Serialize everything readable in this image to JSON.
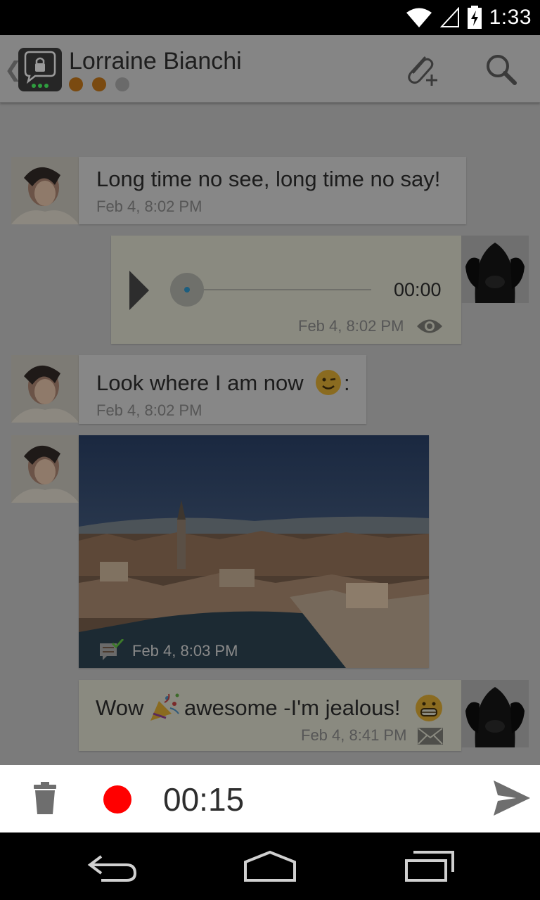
{
  "status_bar": {
    "time": "1:33",
    "icons": [
      "wifi-icon",
      "cell-signal-icon",
      "battery-charging-icon"
    ]
  },
  "header": {
    "back_icon": "chevron-left-icon",
    "app_icon": "locked-chat-icon",
    "contact_name": "Lorraine Bianchi",
    "trust_level_colors": [
      "#b3690d",
      "#b3690d",
      "#9e9e9e"
    ],
    "actions": [
      "attach-add-icon",
      "search-icon"
    ]
  },
  "messages": [
    {
      "direction": "incoming",
      "type": "text",
      "text": "Long time no see, long time no say!",
      "time": "Feb 4, 8:02 PM"
    },
    {
      "direction": "outgoing",
      "type": "audio",
      "duration": "00:00",
      "time": "Feb 4, 8:02 PM",
      "status_icon": "eye-icon"
    },
    {
      "direction": "incoming",
      "type": "text",
      "text": "Look where I am now",
      "emoji_icon": "winking-face-icon",
      "text_suffix": ":",
      "time": "Feb 4, 8:02 PM"
    },
    {
      "direction": "incoming",
      "type": "image",
      "image_icon": "city-photo",
      "time": "Feb 4, 8:03 PM",
      "status_icon": "message-acknowledged-icon"
    },
    {
      "direction": "outgoing",
      "type": "text",
      "text_before_emoji": "Wow",
      "emoji_icons": [
        "party-popper-icon",
        "grinning-face-icon"
      ],
      "text_after_emoji": "awesome -I'm jealous!",
      "time": "Feb 4, 8:41 PM",
      "status_icon": "envelope-icon"
    }
  ],
  "recording": {
    "timer": "00:15",
    "delete_icon": "trash-icon",
    "record_indicator_color": "#ff0000",
    "send_icon": "send-icon"
  },
  "nav_bar": {
    "buttons": [
      "back-icon",
      "home-icon",
      "recent-apps-icon"
    ]
  }
}
